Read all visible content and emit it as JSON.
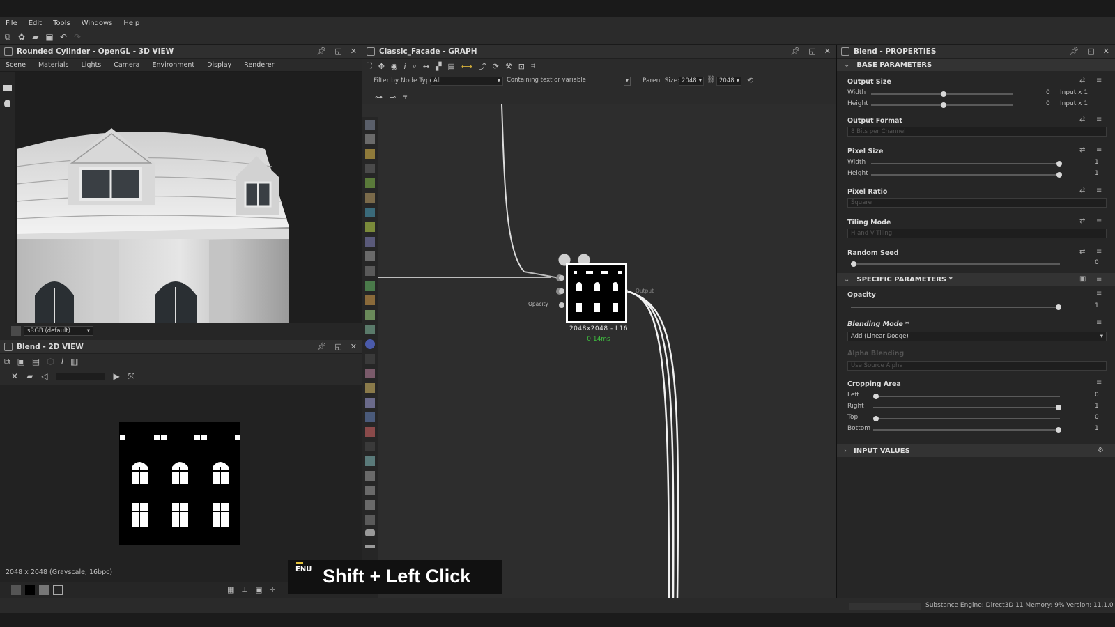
{
  "menu": [
    "File",
    "Edit",
    "Tools",
    "Windows",
    "Help"
  ],
  "view3d": {
    "title": "Rounded Cylinder - OpenGL - 3D VIEW",
    "tabs": [
      "Scene",
      "Materials",
      "Lights",
      "Camera",
      "Environment",
      "Display",
      "Renderer"
    ],
    "colorspace": "sRGB (default)"
  },
  "view2d": {
    "title": "Blend - 2D VIEW",
    "status": "2048 x 2048 (Grayscale, 16bpc)"
  },
  "graph": {
    "title": "Classic_Facade - GRAPH",
    "filter_label": "Filter by Node Type",
    "filter_value": "All",
    "search_placeholder": "Containing text or variable",
    "parent_size_label": "Parent Size:",
    "parent_size_w": "2048",
    "parent_size_h": "2048",
    "node": {
      "resolution": "2048x2048 - L16",
      "timing": "0.14ms",
      "input_opacity": "Opacity",
      "output": "Output"
    }
  },
  "properties": {
    "title": "Blend - PROPERTIES",
    "base_section": "BASE PARAMETERS",
    "output_size": "Output Size",
    "width": "Width",
    "height": "Height",
    "output_size_w_val": "0",
    "output_size_h_val": "0",
    "output_size_w_rel": "Input x 1",
    "output_size_h_rel": "Input x 1",
    "output_format": "Output Format",
    "output_format_value": "8 Bits per Channel",
    "pixel_size": "Pixel Size",
    "pixel_size_w_val": "1",
    "pixel_size_h_val": "1",
    "pixel_ratio": "Pixel Ratio",
    "pixel_ratio_value": "Square",
    "tiling_mode": "Tiling Mode",
    "tiling_mode_value": "H and V Tiling",
    "random_seed": "Random Seed",
    "random_seed_val": "0",
    "specific_section": "SPECIFIC PARAMETERS *",
    "opacity": "Opacity",
    "opacity_val": "1",
    "blending_mode": "Blending Mode *",
    "blending_mode_value": "Add (Linear Dodge)",
    "alpha_blending": "Alpha Blending",
    "alpha_blending_value": "Use Source Alpha",
    "cropping_area": "Cropping Area",
    "crop_left": "Left",
    "crop_right": "Right",
    "crop_top": "Top",
    "crop_bottom": "Bottom",
    "crop_left_val": "0",
    "crop_right_val": "1",
    "crop_top_val": "0",
    "crop_bottom_val": "1",
    "input_section": "INPUT VALUES"
  },
  "status": {
    "engine": "Substance Engine: Direct3D 11 Memory: 9%",
    "version": "Version: 11.1.0"
  },
  "overlay": {
    "lang": "ENU",
    "shortcut": "Shift + Left Click"
  },
  "colors": {
    "accent_green": "#3fbf3f",
    "panel": "#262626",
    "canvas": "#2d2d2d"
  }
}
